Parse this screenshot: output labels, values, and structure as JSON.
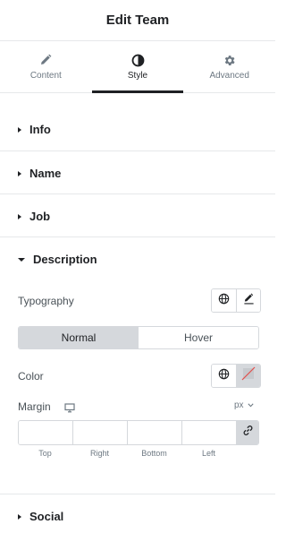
{
  "header": {
    "title": "Edit Team"
  },
  "tabs": [
    {
      "label": "Content",
      "icon": "pencil-icon",
      "active": false
    },
    {
      "label": "Style",
      "icon": "half-circle-icon",
      "active": true
    },
    {
      "label": "Advanced",
      "icon": "gear-icon",
      "active": false
    }
  ],
  "sections": {
    "info": "Info",
    "name": "Name",
    "job": "Job",
    "description": "Description",
    "social": "Social"
  },
  "description": {
    "typography_label": "Typography",
    "state_normal": "Normal",
    "state_hover": "Hover",
    "active_state": "Normal",
    "color_label": "Color",
    "margin_label": "Margin",
    "unit": "px",
    "margin": {
      "top": {
        "label": "Top",
        "value": ""
      },
      "right": {
        "label": "Right",
        "value": ""
      },
      "bottom": {
        "label": "Bottom",
        "value": ""
      },
      "left": {
        "label": "Left",
        "value": ""
      }
    }
  },
  "colors": {
    "accent": "#1f2124",
    "border": "#d5d8dc",
    "muted": "#6d7882",
    "clear_slash": "#e2504c"
  }
}
